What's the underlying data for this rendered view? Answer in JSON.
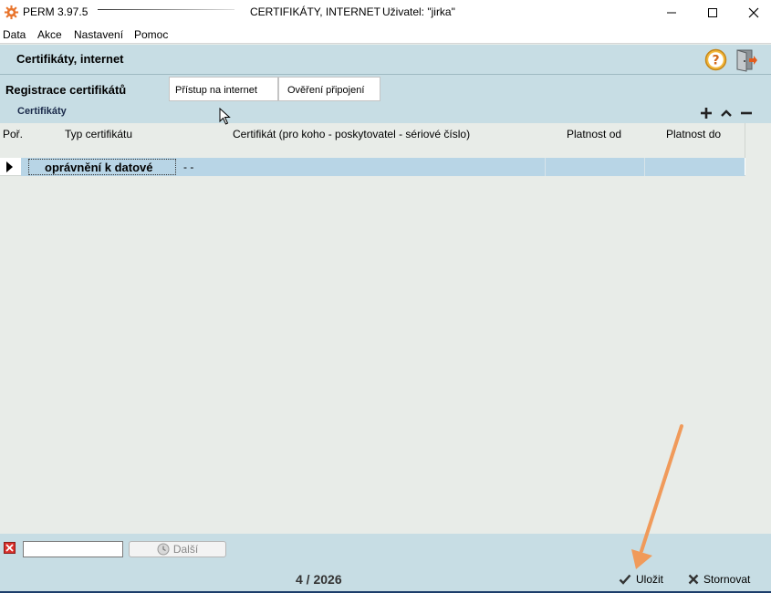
{
  "window": {
    "app_name": "PERM 3.97.5",
    "title": "CERTIFIKÁTY, INTERNET",
    "user": "Uživatel: \"jirka\""
  },
  "menu": [
    "Data",
    "Akce",
    "Nastavení",
    "Pomoc"
  ],
  "header": {
    "title": "Certifikáty, internet"
  },
  "section": {
    "label": "Registrace certifikátů"
  },
  "tabs": [
    "Přístup na internet",
    "Ověření připojení"
  ],
  "certificates": {
    "label": "Certifikáty",
    "columns": [
      "Poř.",
      "Typ certifikátu",
      "Certifikát (pro koho - poskytovatel - sériové číslo)",
      "Platnost od",
      "Platnost do"
    ],
    "rows": [
      {
        "type": "oprávnění k datové",
        "certificate": "-  -",
        "valid_from": "",
        "valid_to": ""
      }
    ]
  },
  "footer": {
    "search_value": "",
    "next_label": "Další",
    "period": "4 / 2026",
    "save_label": "Uložit",
    "cancel_label": "Stornovat"
  },
  "colors": {
    "panel": "#c7dde4",
    "background": "#e8ece8",
    "selected_row": "#b8d5e6",
    "annotation_arrow": "#f09a5a"
  }
}
